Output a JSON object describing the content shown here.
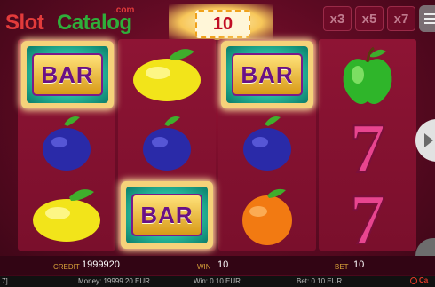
{
  "logo": {
    "slot": "Slot",
    "catalog": "Catalog",
    "com": ".com"
  },
  "marquee": {
    "value": "10"
  },
  "multipliers": [
    "x3",
    "x5",
    "x7"
  ],
  "reels": [
    [
      "BAR",
      "plum-icon",
      "lemon-icon"
    ],
    [
      "lemon-icon",
      "plum-icon",
      "BAR"
    ],
    [
      "BAR",
      "plum-icon",
      "orange-icon"
    ],
    [
      "apple-icon",
      "seven-icon",
      "seven-icon"
    ]
  ],
  "bar_label": "BAR",
  "seven_label": "7",
  "info": {
    "credit_label": "CREDIT",
    "credit_value": "1999920",
    "win_label": "WIN",
    "win_value": "10",
    "bet_label": "BET",
    "bet_value": "10"
  },
  "footer": {
    "left": "7]",
    "money": "Money: 19999.20 EUR",
    "win": "Win: 0.10 EUR",
    "bet": "Bet: 0.10 EUR",
    "brand": "Ca"
  },
  "colors": {
    "accent": "#c10d24",
    "gold": "#d9a23a",
    "teal": "#2ec7a6",
    "purple": "#6a1185"
  }
}
